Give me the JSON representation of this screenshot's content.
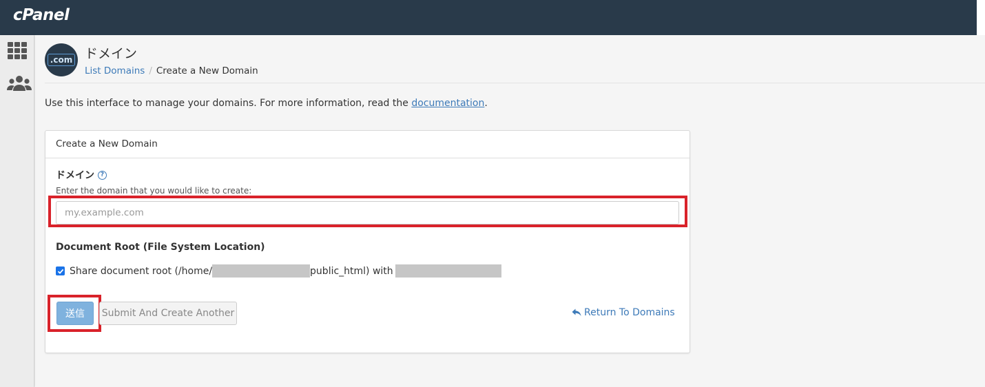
{
  "brand": {
    "logo_text": "cPanel"
  },
  "sidebar": {
    "items": [
      {
        "icon": "grid-icon",
        "label": ""
      },
      {
        "icon": "users-icon",
        "label": ""
      }
    ]
  },
  "header": {
    "icon_text": ".com",
    "title": "ドメイン",
    "breadcrumb": {
      "parent": "List Domains",
      "separator": "/",
      "current": "Create a New Domain"
    }
  },
  "intro": {
    "text_before": "Use this interface to manage your domains. For more information, read the ",
    "link": "documentation",
    "text_after": "."
  },
  "form": {
    "panel_title": "Create a New Domain",
    "domain_label": "ドメイン",
    "help_glyph": "?",
    "domain_description": "Enter the domain that you would like to create:",
    "domain_placeholder": "my.example.com",
    "domain_value": "",
    "docroot_label": "Document Root (File System Location)",
    "share_docroot": {
      "checked": true,
      "text_before": "Share document root (/home/",
      "text_middle": "public_html) with",
      "text_after": ""
    },
    "submit_label": "送信",
    "submit_another_label": "Submit And Create Another",
    "return_label": "Return To Domains"
  },
  "colors": {
    "topbar": "#293a4a",
    "link": "#3d7ab8",
    "highlight": "#d9222a",
    "primary_button": "#7fb2de",
    "checkbox": "#1a73e8"
  }
}
